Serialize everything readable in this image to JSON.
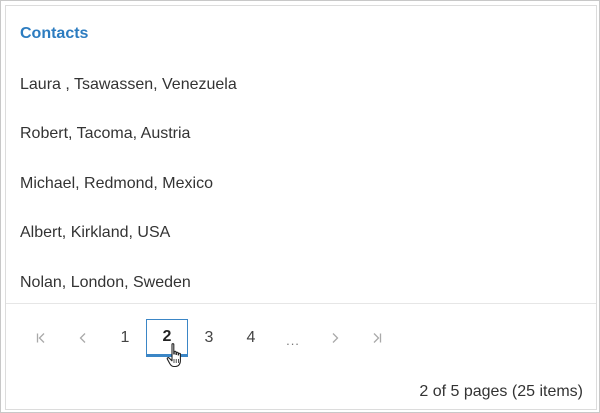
{
  "list": {
    "title": "Contacts",
    "items": [
      {
        "label": "Laura , Tsawassen, Venezuela"
      },
      {
        "label": "Robert, Tacoma, Austria"
      },
      {
        "label": "Michael, Redmond, Mexico"
      },
      {
        "label": "Albert, Kirkland, USA"
      },
      {
        "label": "Nolan, London, Sweden"
      }
    ]
  },
  "pager": {
    "pages": [
      "1",
      "2",
      "3",
      "4"
    ],
    "current_page": "2",
    "ellipsis": "...",
    "summary": "2 of 5 pages (25 items)",
    "icons": {
      "first": "first-page-icon",
      "prev": "previous-page-icon",
      "next": "next-page-icon",
      "last": "last-page-icon"
    }
  },
  "colors": {
    "accent": "#2c7cc0",
    "active_border": "#3b86c6",
    "text": "#333333",
    "muted_icon": "#a9a9a9"
  }
}
